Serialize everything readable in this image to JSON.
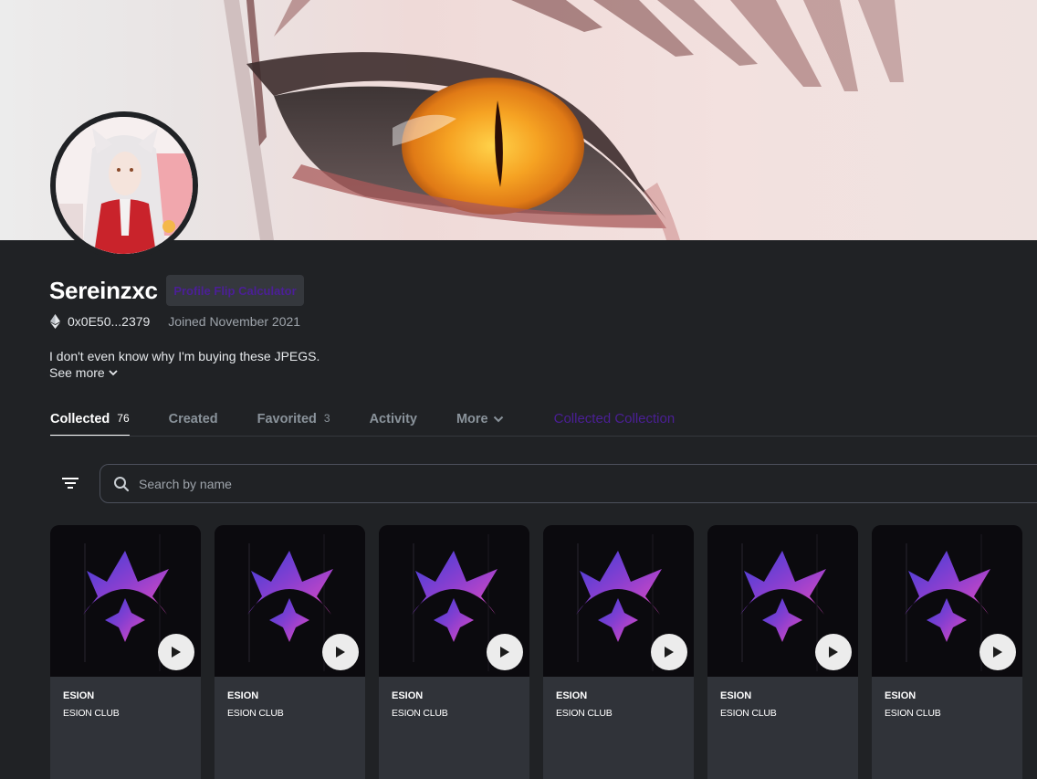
{
  "profile": {
    "username": "Sereinzxc",
    "flip_button_label": "Profile Flip Calculator",
    "wallet_address": "0x0E50...2379",
    "joined": "Joined November 2021",
    "bio": "I don't even know why I'm buying these JPEGS.",
    "see_more": "See more"
  },
  "tabs": [
    {
      "label": "Collected",
      "count": "76",
      "active": true
    },
    {
      "label": "Created",
      "count": "",
      "active": false
    },
    {
      "label": "Favorited",
      "count": "3",
      "active": false
    },
    {
      "label": "Activity",
      "count": "",
      "active": false
    },
    {
      "label": "More",
      "count": "",
      "active": false
    },
    {
      "label": "Collected Collection",
      "count": "",
      "active": false
    }
  ],
  "search": {
    "placeholder": "Search by name"
  },
  "cards": [
    {
      "name": "ESION",
      "collection": "ESION CLUB"
    },
    {
      "name": "ESION",
      "collection": "ESION CLUB"
    },
    {
      "name": "ESION",
      "collection": "ESION CLUB"
    },
    {
      "name": "ESION",
      "collection": "ESION CLUB"
    },
    {
      "name": "ESION",
      "collection": "ESION CLUB"
    },
    {
      "name": "ESION",
      "collection": "ESION CLUB"
    }
  ],
  "colors": {
    "background": "#202225",
    "card": "#303339",
    "accent_purple": "#4b1f96",
    "iris_orange": "#f0a020"
  }
}
